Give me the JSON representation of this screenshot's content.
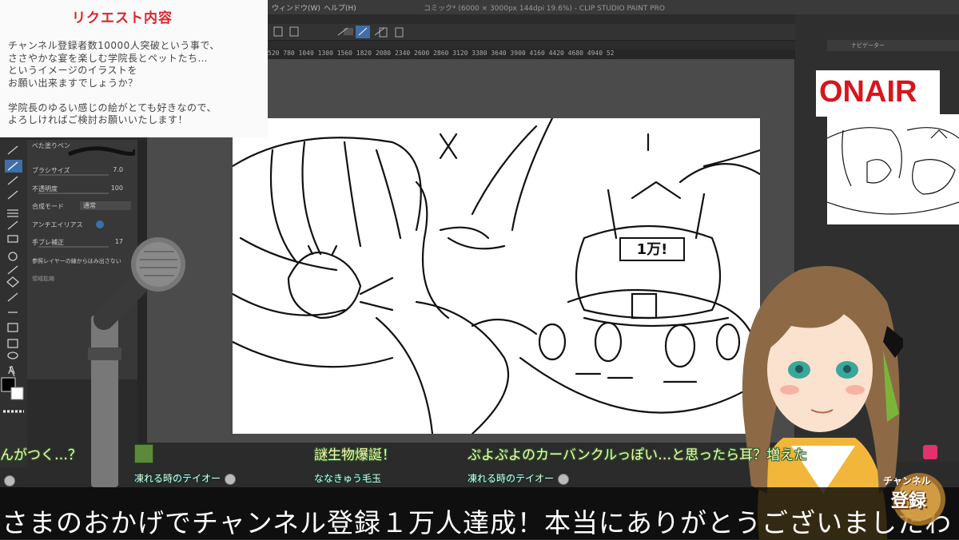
{
  "app": {
    "window_title": "コミック* (6000 × 3000px 144dpi 19.6%) - CLIP STUDIO PAINT PRO",
    "menu": [
      "ウィンドウ(W)",
      "ヘルプ(H)"
    ],
    "ruler_ticks": "520 780 1040 1300 1560 1820 2080 2340 2600 2860 3120 3380 3640 3900 4160 4420 4680 4940 52",
    "navigator_label": "ナビゲーター"
  },
  "tool_property": {
    "brush_name": "べた塗りペン",
    "brush_size_label": "ブラシサイズ",
    "brush_size_value": "7.0",
    "opacity_label": "不透明度",
    "opacity_value": "100",
    "blend_label": "合成モード",
    "blend_value": "通常",
    "antialias_label": "アンチエイリアス",
    "stabilize_label": "手ブレ補正",
    "stabilize_value": "17",
    "ref_layer_label": "参照レイヤーの線からはみ出さない",
    "ref_sub_label": "領域拡縮"
  },
  "request": {
    "title": "リクエスト内容",
    "body": "チャンネル登録者数10000人突破という事で、\nささやかな宴を楽しむ学院長とペットたち…\nというイメージのイラストを\nお願い出来ますでしょうか？\n\n学院長のゆるい感じの絵がとても好きなので、\nよろしければご検討お願いいたします！"
  },
  "onair": "ONAIR",
  "cake_sign": "1万!",
  "chat": [
    {
      "message": "んがつく…？",
      "name": ""
    },
    {
      "message": "",
      "name": "凍れる時のテイオー"
    },
    {
      "message": "謎生物爆誕！",
      "name": "ななきゅう毛玉"
    },
    {
      "message": "ぷよぷよのカーバンクルっぽい…と思ったら耳？増えた",
      "name": "凍れる時のテイオー"
    }
  ],
  "banner": "さまのおかげでチャンネル登録１万人達成！本当にありがとうございましたわ",
  "badge": {
    "line1": "チャンネル",
    "line2": "登録"
  },
  "colors": {
    "accent_red": "#d7161c",
    "banner_bg": "#0a0a0a",
    "chat_text": "#fff7b0"
  }
}
